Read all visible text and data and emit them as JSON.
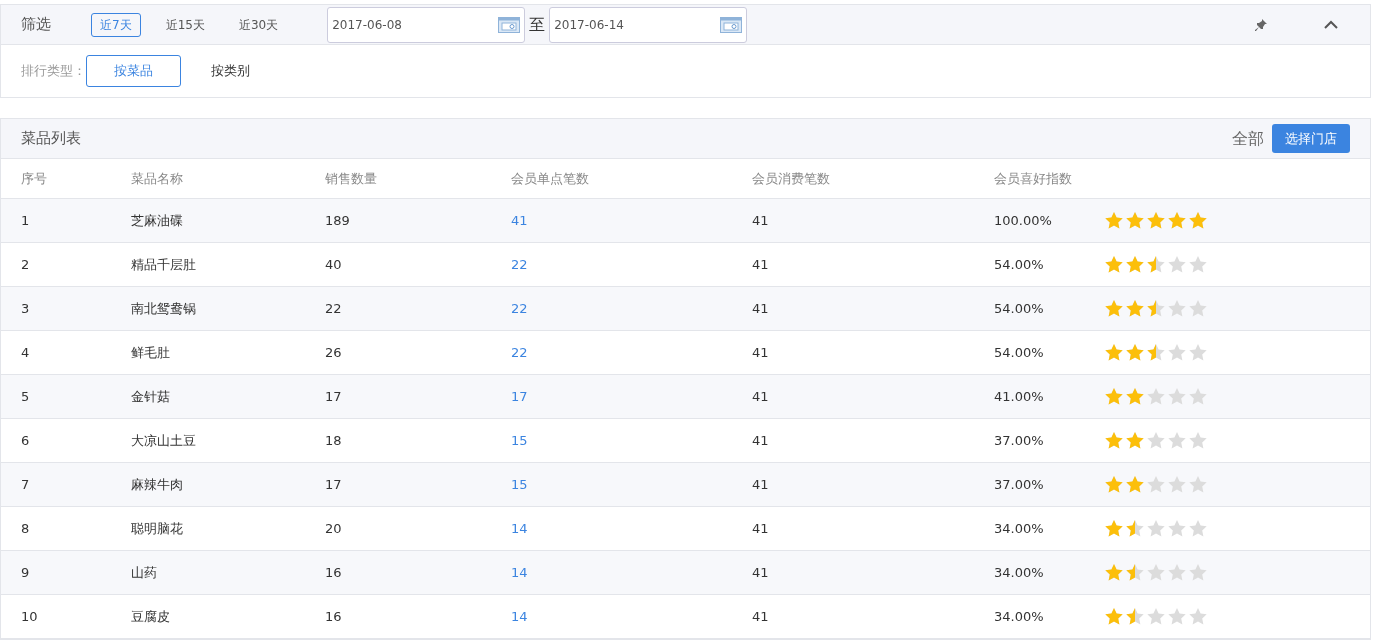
{
  "filter": {
    "title": "筛选",
    "ranges": [
      {
        "label": "近7天",
        "selected": true
      },
      {
        "label": "近15天",
        "selected": false
      },
      {
        "label": "近30天",
        "selected": false
      }
    ],
    "date_from": "2017-06-08",
    "date_sep": "至",
    "date_to": "2017-06-14",
    "rank_label": "排行类型：",
    "rank_types": [
      {
        "label": "按菜品",
        "selected": true
      },
      {
        "label": "按类别",
        "selected": false
      }
    ]
  },
  "list": {
    "title": "菜品列表",
    "store_scope": "全部",
    "store_button": "选择门店",
    "columns": [
      "序号",
      "菜品名称",
      "销售数量",
      "会员单点笔数",
      "会员消费笔数",
      "会员喜好指数"
    ],
    "rows": [
      {
        "index": "1",
        "name": "芝麻油碟",
        "sales": "189",
        "member_single": "41",
        "member_orders": "41",
        "preference": "100.00%",
        "stars": 5
      },
      {
        "index": "2",
        "name": "精品千层肚",
        "sales": "40",
        "member_single": "22",
        "member_orders": "41",
        "preference": "54.00%",
        "stars": 2.5
      },
      {
        "index": "3",
        "name": "南北鸳鸯锅",
        "sales": "22",
        "member_single": "22",
        "member_orders": "41",
        "preference": "54.00%",
        "stars": 2.5
      },
      {
        "index": "4",
        "name": "鲜毛肚",
        "sales": "26",
        "member_single": "22",
        "member_orders": "41",
        "preference": "54.00%",
        "stars": 2.5
      },
      {
        "index": "5",
        "name": "金针菇",
        "sales": "17",
        "member_single": "17",
        "member_orders": "41",
        "preference": "41.00%",
        "stars": 2
      },
      {
        "index": "6",
        "name": "大凉山土豆",
        "sales": "18",
        "member_single": "15",
        "member_orders": "41",
        "preference": "37.00%",
        "stars": 2
      },
      {
        "index": "7",
        "name": "麻辣牛肉",
        "sales": "17",
        "member_single": "15",
        "member_orders": "41",
        "preference": "37.00%",
        "stars": 2
      },
      {
        "index": "8",
        "name": "聪明脑花",
        "sales": "20",
        "member_single": "14",
        "member_orders": "41",
        "preference": "34.00%",
        "stars": 1.5
      },
      {
        "index": "9",
        "name": "山药",
        "sales": "16",
        "member_single": "14",
        "member_orders": "41",
        "preference": "34.00%",
        "stars": 1.5
      },
      {
        "index": "10",
        "name": "豆腐皮",
        "sales": "16",
        "member_single": "14",
        "member_orders": "41",
        "preference": "34.00%",
        "stars": 1.5
      }
    ]
  }
}
